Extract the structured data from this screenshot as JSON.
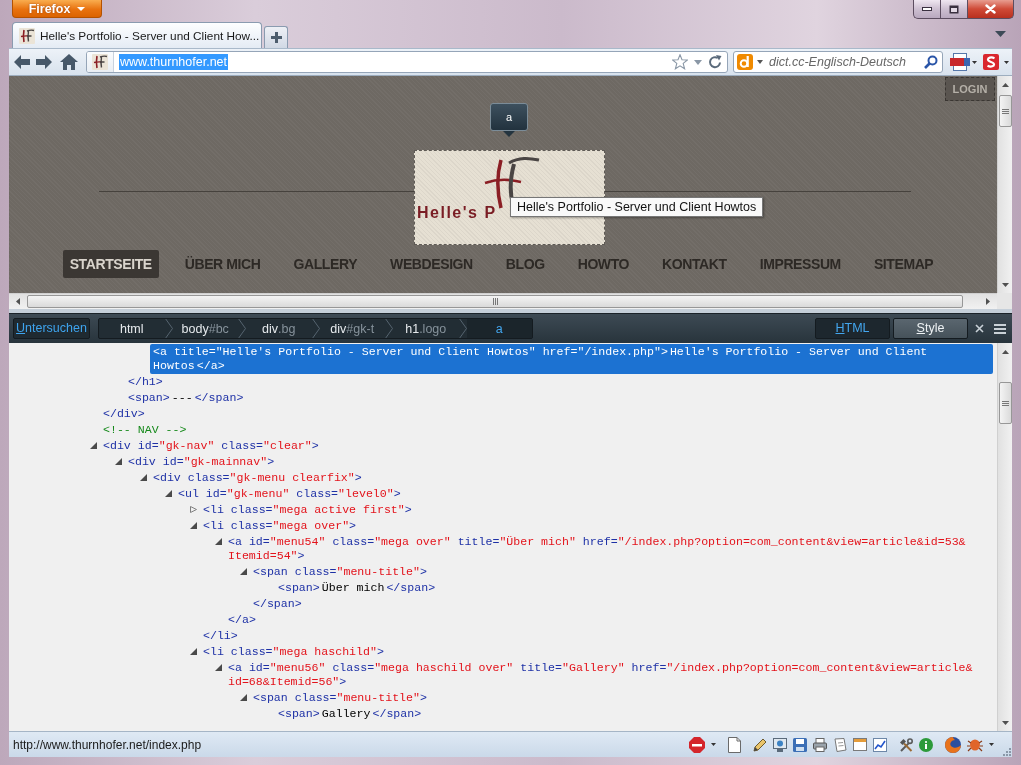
{
  "browser": {
    "menu_button": "Firefox"
  },
  "tabs": [
    {
      "title": "Helle's Portfolio - Server und Client How...",
      "selected": true
    }
  ],
  "address_bar": {
    "value": "www.thurnhofer.net",
    "highlighted": true
  },
  "search": {
    "placeholder": "dict.cc-Englisch-Deutsch"
  },
  "page": {
    "login_button": "LOGIN",
    "element_label": "a",
    "logo_text": "Helle's P",
    "tooltip": "Helle's Portfolio - Server und Client Howtos",
    "menu": [
      {
        "label": "STARTSEITE",
        "selected": true
      },
      {
        "label": "ÜBER MICH",
        "selected": false
      },
      {
        "label": "GALLERY",
        "selected": false
      },
      {
        "label": "WEBDESIGN",
        "selected": false
      },
      {
        "label": "BLOG",
        "selected": false
      },
      {
        "label": "HOWTO",
        "selected": false
      },
      {
        "label": "KONTAKT",
        "selected": false
      },
      {
        "label": "IMPRESSUM",
        "selected": false
      },
      {
        "label": "SITEMAP",
        "selected": false
      }
    ]
  },
  "inspector": {
    "inspect_button": "Untersuchen",
    "breadcrumbs": [
      {
        "tag": "html",
        "selected": false
      },
      {
        "tag": "body",
        "detail": "#bc",
        "selected": false
      },
      {
        "tag": "div",
        "detail": ".bg",
        "selected": false
      },
      {
        "tag": "div",
        "detail": "#gk-t",
        "selected": false
      },
      {
        "tag": "h1",
        "detail": ".logo",
        "selected": false
      },
      {
        "tag": "a",
        "selected": true
      }
    ],
    "panel_tabs": [
      {
        "label": "HTML",
        "selected": true
      },
      {
        "label": "Style",
        "selected": false
      }
    ],
    "tree": [
      {
        "kind": "element",
        "selected": false,
        "children": [
          {
            "selected": false,
            "children": [
              {
                "open": "<a title=\"Helle's Portfolio - Server und Client Howtos\" href=\"/index.php\">Helle's Portfolio - Server und Client Howtos</a>",
                "selected": true
              }
            ],
            "close": "</h1>"
          },
          {
            "open": "<span>---</span>",
            "selected": false
          }
        ],
        "close": "</div>"
      },
      {
        "kind": "comment",
        "open": "<!-- NAV -->",
        "selected": false
      },
      {
        "kind": "element",
        "open": "<div id=\"gk-nav\" class=\"clear\">",
        "expanded": true,
        "selected": false,
        "children": [
          {
            "open": "<div id=\"gk-mainnav\">",
            "expanded": true,
            "selected": false,
            "children": [
              {
                "open": "<div class=\"gk-menu clearfix\">",
                "expanded": true,
                "selected": false,
                "children": [
                  {
                    "open": "<ul id=\"gk-menu\" class=\"level0\">",
                    "expanded": true,
                    "selected": false,
                    "children": [
                      {
                        "open": "<li class=\"mega active first\">",
                        "expanded": false,
                        "selected": false
                      },
                      {
                        "open": "<li class=\"mega over\">",
                        "expanded": true,
                        "selected": false,
                        "children": [
                          {
                            "open": "<a id=\"menu54\" class=\"mega over\" title=\"Über mich\" href=\"/index.php?option=com_content&view=article&id=53&Itemid=54\">",
                            "expanded": true,
                            "selected": false,
                            "children": [
                              {
                                "open": "<span class=\"menu-title\">",
                                "expanded": true,
                                "selected": false,
                                "children": [
                                  {
                                    "open": "<span>Über mich</span>",
                                    "selected": false
                                  }
                                ],
                                "close": "</span>"
                              }
                            ],
                            "close": "</a>"
                          }
                        ],
                        "close": "</li>"
                      },
                      {
                        "open": "<li class=\"mega haschild\">",
                        "expanded": true,
                        "selected": false,
                        "children": [
                          {
                            "open": "<a id=\"menu56\" class=\"mega haschild over\" title=\"Gallery\" href=\"/index.php?option=com_content&view=article&id=68&Itemid=56\">",
                            "expanded": true,
                            "selected": false,
                            "children": [
                              {
                                "open": "<span class=\"menu-title\">",
                                "expanded": true,
                                "selected": false,
                                "children": [
                                  {
                                    "open": "<span>Gallery</span>",
                                    "selected": false
                                  }
                                ]
                              }
                            ]
                          }
                        ]
                      }
                    ]
                  }
                ]
              }
            ]
          }
        ]
      }
    ]
  },
  "status_bar": {
    "text": "http://www.thurnhofer.net/index.php"
  }
}
